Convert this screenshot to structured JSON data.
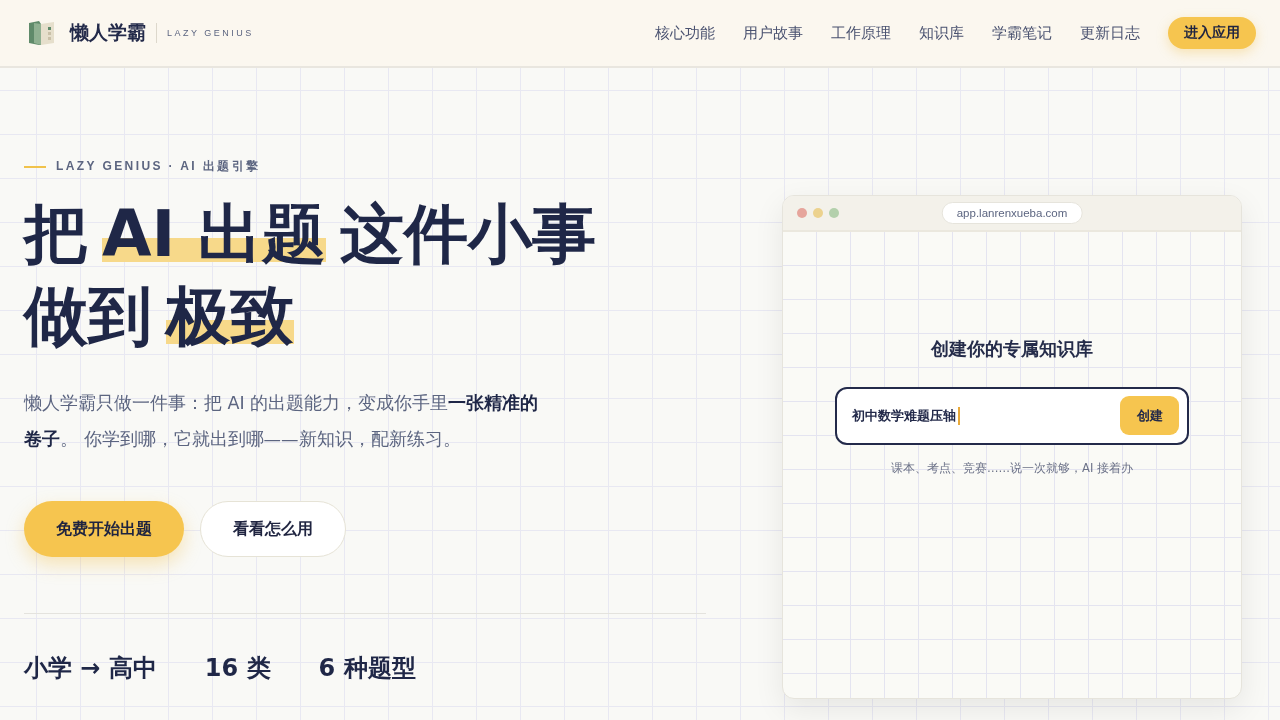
{
  "brand": {
    "name": "懒人学霸",
    "tagline": "LAZY GENIUS"
  },
  "nav": {
    "links": [
      "核心功能",
      "用户故事",
      "工作原理",
      "知识库",
      "学霸笔记",
      "更新日志"
    ],
    "cta": "进入应用"
  },
  "hero": {
    "eyebrow": "LAZY GENIUS · AI 出题引擎",
    "headline": [
      [
        {
          "text": "把",
          "highlight": false
        },
        {
          "text": "AI 出题",
          "highlight": true
        },
        {
          "text": "这件小事",
          "highlight": false
        }
      ],
      [
        {
          "text": "做到",
          "highlight": false
        },
        {
          "text": "极致",
          "highlight": true
        }
      ]
    ],
    "description": "懒人学霸只做一件事：把 AI 的出题能力，变成你手里**一张精准的卷子**。 你学到哪，它就出到哪——新知识，配新练习。",
    "buttons": [
      {
        "label": "免费开始出题",
        "kind": "primary"
      },
      {
        "label": "看看怎么用",
        "kind": "secondary"
      }
    ],
    "stats": [
      "小学 → 高中",
      "16 类",
      "6 种题型"
    ]
  },
  "preview": {
    "url": "app.lanrenxueba.com",
    "title": "创建你的专属知识库",
    "input_value": "初中数学难题压轴",
    "button": "创建",
    "hint": "课本、考点、竞赛……说一次就够，AI 接着办"
  }
}
